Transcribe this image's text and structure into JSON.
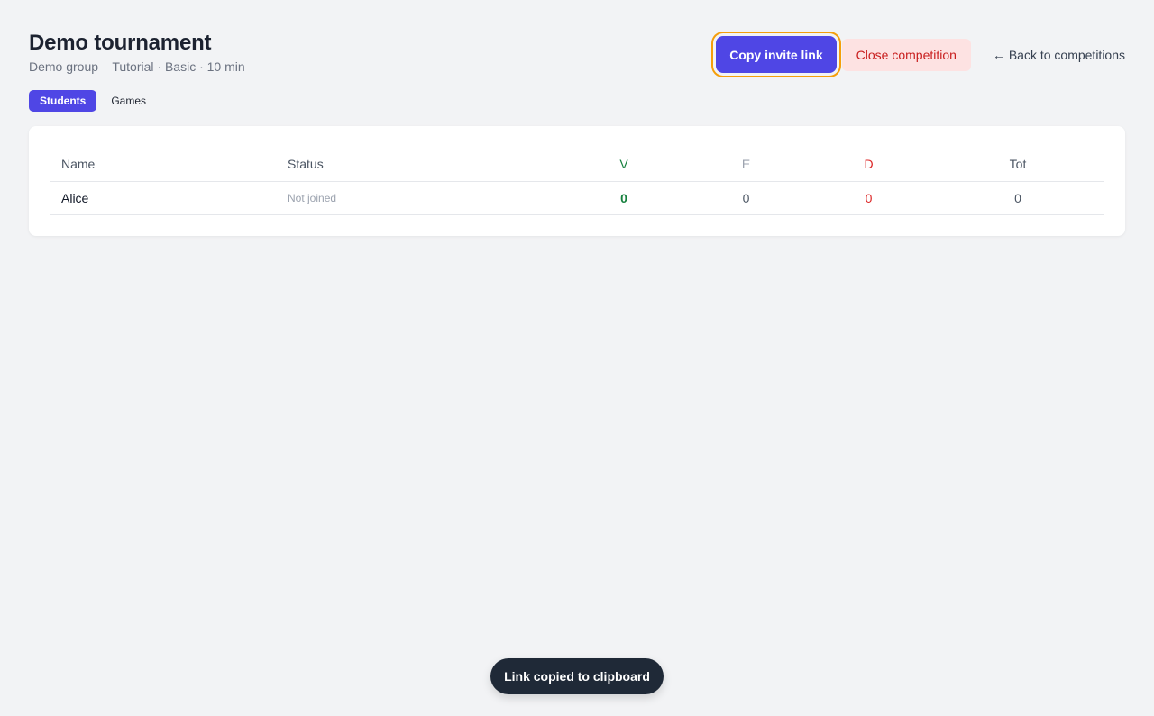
{
  "header": {
    "title": "Demo tournament",
    "subtitle": "Demo group – Tutorial · Basic · 10 min"
  },
  "actions": {
    "copy_label": "Copy invite link",
    "close_label": "Close competition",
    "back_label": "← Back to competitions"
  },
  "tabs": [
    {
      "label": "Students",
      "active": true
    },
    {
      "label": "Games",
      "active": false
    }
  ],
  "table": {
    "columns": [
      "Name",
      "Status",
      "V",
      "E",
      "D",
      "Tot"
    ],
    "rows": [
      {
        "name": "Alice",
        "status": "Not joined",
        "v": "0",
        "e": "0",
        "d": "0",
        "tot": "0"
      }
    ]
  },
  "toast": {
    "text": "Link copied to clipboard"
  },
  "colors": {
    "accent": "#4f46e5",
    "focus_ring": "#f59e0b",
    "danger_bg": "#fde2e2",
    "danger_text": "#c81e1e",
    "win": "#15803d",
    "loss": "#dc2626"
  }
}
